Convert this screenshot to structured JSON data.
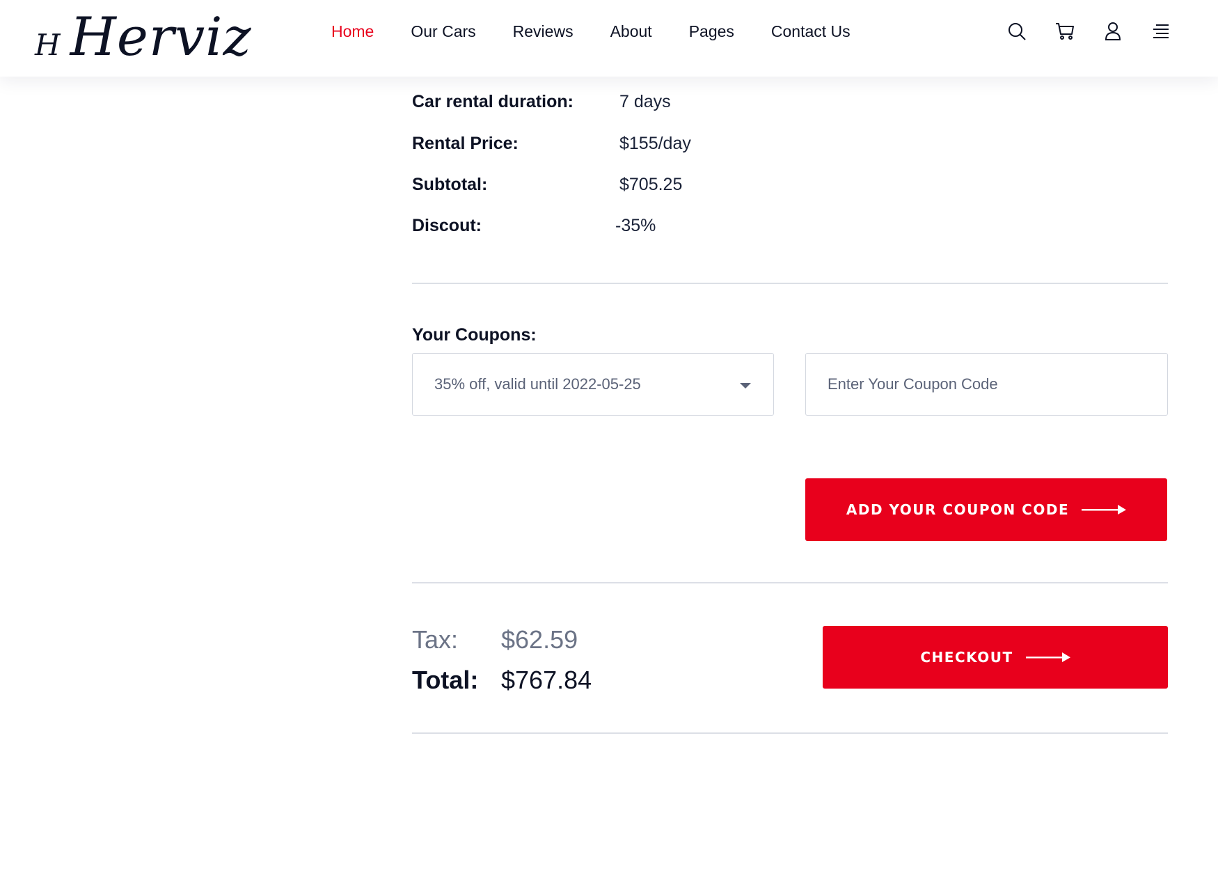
{
  "brand": {
    "mark": "H",
    "name": "Herviz"
  },
  "nav": {
    "items": [
      {
        "label": "Home",
        "active": true
      },
      {
        "label": "Our Cars",
        "active": false
      },
      {
        "label": "Reviews",
        "active": false
      },
      {
        "label": "About",
        "active": false
      },
      {
        "label": "Pages",
        "active": false
      },
      {
        "label": "Contact Us",
        "active": false
      }
    ]
  },
  "header_icons": [
    "search-icon",
    "cart-icon",
    "user-icon",
    "menu-icon"
  ],
  "summary": {
    "duration": {
      "label": "Car rental duration:",
      "value": "7 days"
    },
    "price": {
      "label": "Rental Price:",
      "value": "$155/day"
    },
    "subtotal": {
      "label": "Subtotal:",
      "value": "$705.25"
    },
    "discount": {
      "label": "Discout:",
      "value": "-35%"
    }
  },
  "coupons": {
    "label": "Your Coupons:",
    "selected": "35% off, valid until 2022-05-25",
    "input_placeholder": "Enter Your Coupon Code",
    "add_button_label": "ADD YOUR COUPON CODE"
  },
  "totals": {
    "tax_label": "Tax:",
    "tax_value": "$62.59",
    "total_label": "Total:",
    "total_value": "$767.84",
    "checkout_label": "CHECKOUT"
  },
  "colors": {
    "accent": "#e8001c",
    "text": "#0d1224",
    "muted": "#6b7386",
    "divider": "#dcdfe6"
  }
}
